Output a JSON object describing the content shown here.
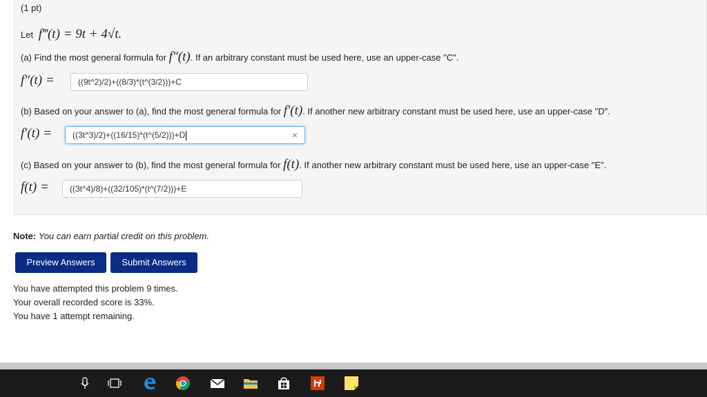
{
  "problem": {
    "points": "(1 pt)",
    "let_text": "Let",
    "let_math": "f‴(t) = 9t + 4√t.",
    "part_a": {
      "prefix": "(a) Find the most general formula for",
      "math": "f″(t)",
      "suffix": ". If an arbitrary constant must be used here, use an upper-case \"C\".",
      "label": "f″(t) =",
      "answer": "((9t^2)/2)+((8/3)*(t^(3/2)))+C"
    },
    "part_b": {
      "prefix": "(b) Based on your answer to (a), find the most general formula for",
      "math": "f′(t)",
      "suffix": ". If another new arbitrary constant must be used here, use an upper-case \"D\".",
      "label": "f′(t) =",
      "answer": "((3t^3)/2)+((16/15)*(t^(5/2)))+D",
      "clear_symbol": "×"
    },
    "part_c": {
      "prefix": "(c) Based on your answer to (b), find the most general formula for",
      "math": "f(t)",
      "suffix": ". If another new arbitrary constant must be used here, use an upper-case \"E\".",
      "label": "f(t) =",
      "answer": "((3t^4)/8)+((32/105)*(t^(7/2)))+E"
    }
  },
  "note": {
    "label": "Note:",
    "text": "You can earn partial credit on this problem."
  },
  "buttons": {
    "preview": "Preview Answers",
    "submit": "Submit Answers"
  },
  "status": {
    "attempted": "You have attempted this problem 9 times.",
    "score": "Your overall recorded score is 33%.",
    "remaining": "You have 1 attempt remaining."
  },
  "taskbar": {
    "icons": [
      "microphone-icon",
      "task-view-icon",
      "edge-icon",
      "chrome-icon",
      "mail-icon",
      "file-explorer-icon",
      "store-icon",
      "office-icon",
      "sticky-notes-icon"
    ]
  },
  "colors": {
    "button_bg": "#0a2c87",
    "taskbar_bg": "#1b1b1b",
    "focus_border": "#66afe9"
  }
}
